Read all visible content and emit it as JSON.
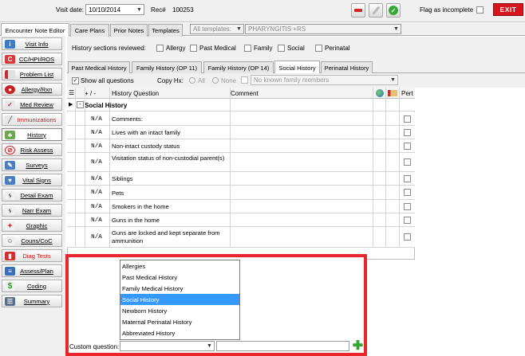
{
  "header": {
    "visit_date_label": "Visit date:",
    "visit_date": "10/10/2014",
    "rec_label": "Rec#",
    "rec_number": "100253",
    "flag_label": "Flag as incomplete",
    "exit_label": "EXIT"
  },
  "main_tabs": [
    "Encounter Note Editor",
    "Care Plans",
    "Prior Notes",
    "Templates"
  ],
  "templates": {
    "all_templates_placeholder": "All templates:",
    "selected_template": "PHARYNGITIS +RS"
  },
  "history_sections": {
    "label": "History sections reviewed:",
    "items": [
      "Allergy",
      "Past Medical",
      "Family",
      "Social",
      "Perinatal"
    ]
  },
  "sidebar": {
    "items": [
      {
        "label": "Visit Info",
        "icon": "visit-info-icon"
      },
      {
        "label": "CC/HPI/ROS",
        "icon": "cc-hpi-icon"
      },
      {
        "label": "Problem List",
        "icon": "problem-list-icon"
      },
      {
        "label": "Allergy/Rxn",
        "icon": "allergy-icon"
      },
      {
        "label": "Med Review",
        "icon": "med-review-icon"
      },
      {
        "label": "Immunizations",
        "icon": "syringe-icon"
      },
      {
        "label": "History",
        "icon": "history-icon"
      },
      {
        "label": "Risk Assess",
        "icon": "risk-icon"
      },
      {
        "label": "Surveys",
        "icon": "survey-icon"
      },
      {
        "label": "Vital Signs",
        "icon": "vitals-icon"
      },
      {
        "label": "Detail Exam",
        "icon": "stethoscope-icon"
      },
      {
        "label": "Narr Exam",
        "icon": "stethoscope-icon"
      },
      {
        "label": "Graphic",
        "icon": "body-icon"
      },
      {
        "label": "Couns/CoC",
        "icon": "counsel-icon"
      },
      {
        "label": "Diag Tests",
        "icon": "diag-icon"
      },
      {
        "label": "Assess/Plan",
        "icon": "assess-icon"
      },
      {
        "label": "Coding",
        "icon": "dollar-icon"
      },
      {
        "label": "Summary",
        "icon": "summary-icon"
      }
    ]
  },
  "history_tabs": [
    "Past Medical History",
    "Family History (OP 11)",
    "Family History (OP 14)",
    "Social History",
    "Perinatal History"
  ],
  "options": {
    "show_all_label": "Show all questions",
    "copy_hx_label": "Copy Hx:",
    "radio_all": "All",
    "radio_none": "None",
    "family_placeholder": "No known family members"
  },
  "grid": {
    "col_plusminus": "+ / -",
    "col_question": "History Question",
    "col_comment": "Comment",
    "col_pert": "Pert",
    "group_title": "Social History",
    "rows": [
      {
        "value": "N/A",
        "question": "Comments:"
      },
      {
        "value": "N/A",
        "question": "Lives with an intact family"
      },
      {
        "value": "N/A",
        "question": "Non-intact custody status"
      },
      {
        "value": "N/A",
        "question": "Visitation status of non-custodial parent(s)"
      },
      {
        "value": "N/A",
        "question": "Siblings"
      },
      {
        "value": "N/A",
        "question": "Pets"
      },
      {
        "value": "N/A",
        "question": "Smokers in the home"
      },
      {
        "value": "N/A",
        "question": "Guns in the home"
      },
      {
        "value": "N/A",
        "question": "Guns are locked and kept separate from ammunition"
      }
    ]
  },
  "dropdown": {
    "options": [
      "Allergies",
      "Past Medical History",
      "Family Medical History",
      "Social History",
      "Newborn History",
      "Maternal Perinatal History",
      "Abbreviated History"
    ],
    "selected": "Social History"
  },
  "custom_question": {
    "label": "Custom question:"
  },
  "colors": {
    "highlight_border": "#e8262b",
    "selection": "#3399ff",
    "exit_button": "#d8141c",
    "add_button": "#2ea82e"
  }
}
